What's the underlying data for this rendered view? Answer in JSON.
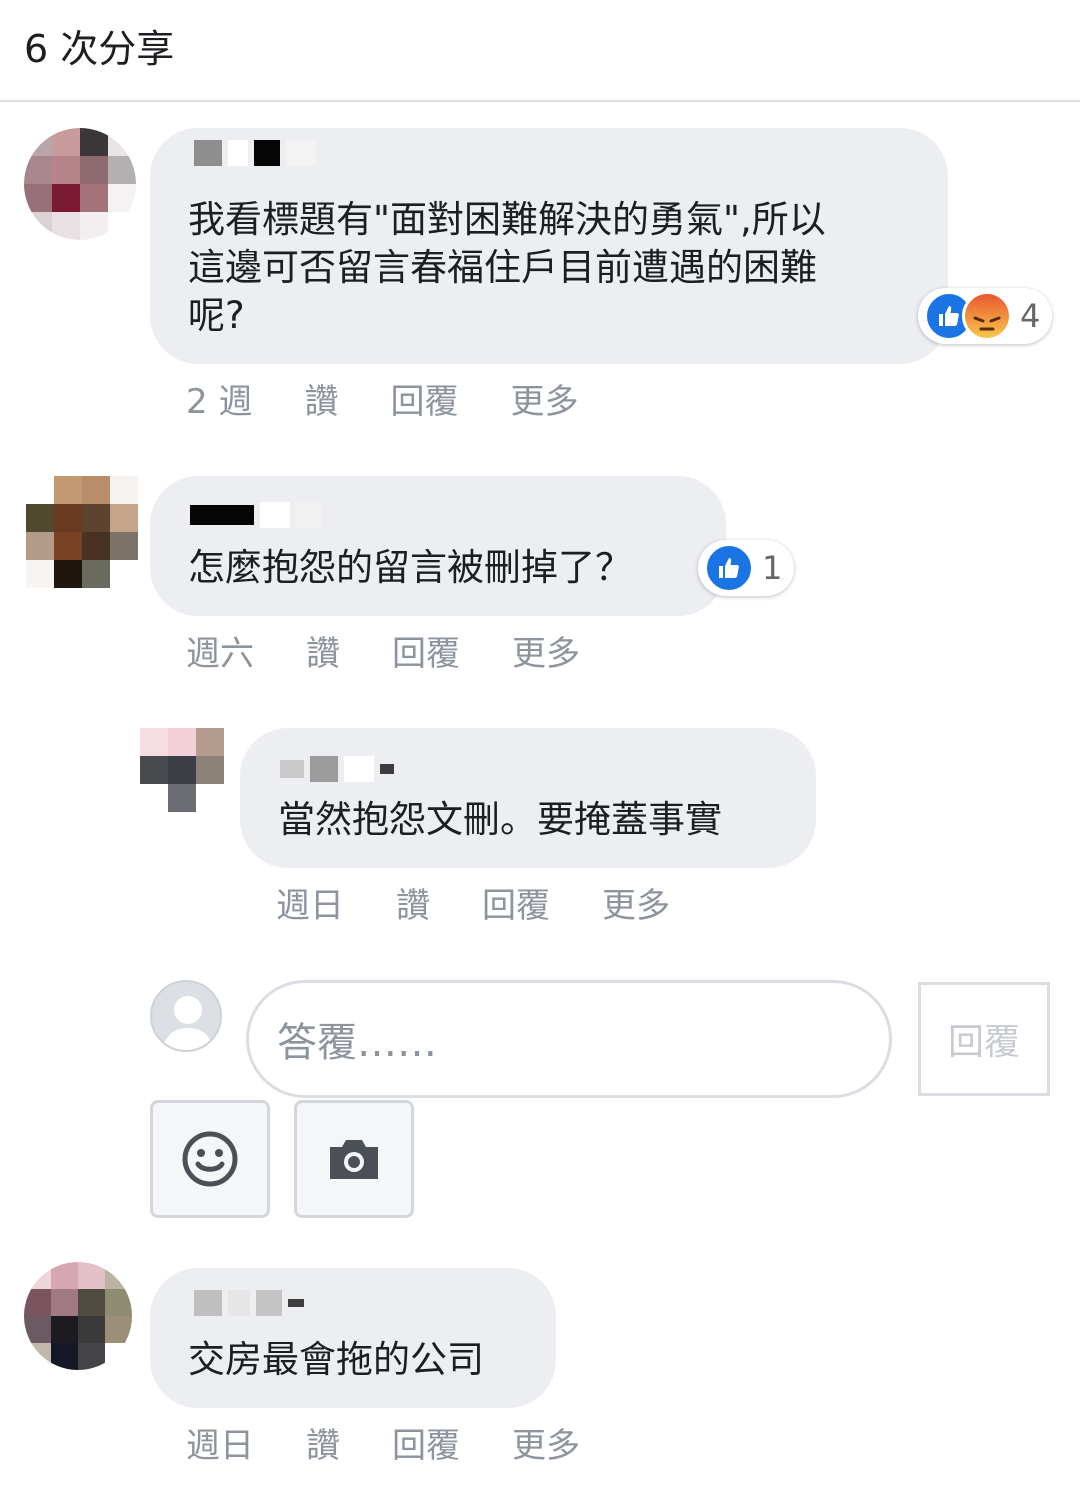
{
  "header": {
    "shares": "6 次分享"
  },
  "comments": [
    {
      "text": "我看標題有\"面對困難解決的勇氣\",所以\n這邊可否留言春福住戶目前遭遇的困難\n呢?",
      "reactions_count": "4",
      "actions": {
        "time": "2 週",
        "like": "讚",
        "reply": "回覆",
        "more": "更多"
      }
    },
    {
      "text": "怎麼抱怨的留言被刪掉了？",
      "reactions_count": "1",
      "actions": {
        "time": "週六",
        "like": "讚",
        "reply": "回覆",
        "more": "更多"
      }
    },
    {
      "text": "當然抱怨文刪。要掩蓋事實",
      "actions": {
        "time": "週日",
        "like": "讚",
        "reply": "回覆",
        "more": "更多"
      }
    },
    {
      "text": "交房最會拖的公司",
      "actions": {
        "time": "週日",
        "like": "讚",
        "reply": "回覆",
        "more": "更多"
      }
    }
  ],
  "reply_box": {
    "placeholder": "答覆……",
    "submit_label": "回覆"
  },
  "icons": {
    "like": "thumbs-up-icon",
    "angry": "angry-face-icon",
    "emoji": "smiley-icon",
    "camera": "camera-icon",
    "avatar": "default-avatar-icon"
  },
  "colors": {
    "like_blue": "#1b74e4",
    "bubble": "#eceef1",
    "muted_text": "#8d949e"
  }
}
